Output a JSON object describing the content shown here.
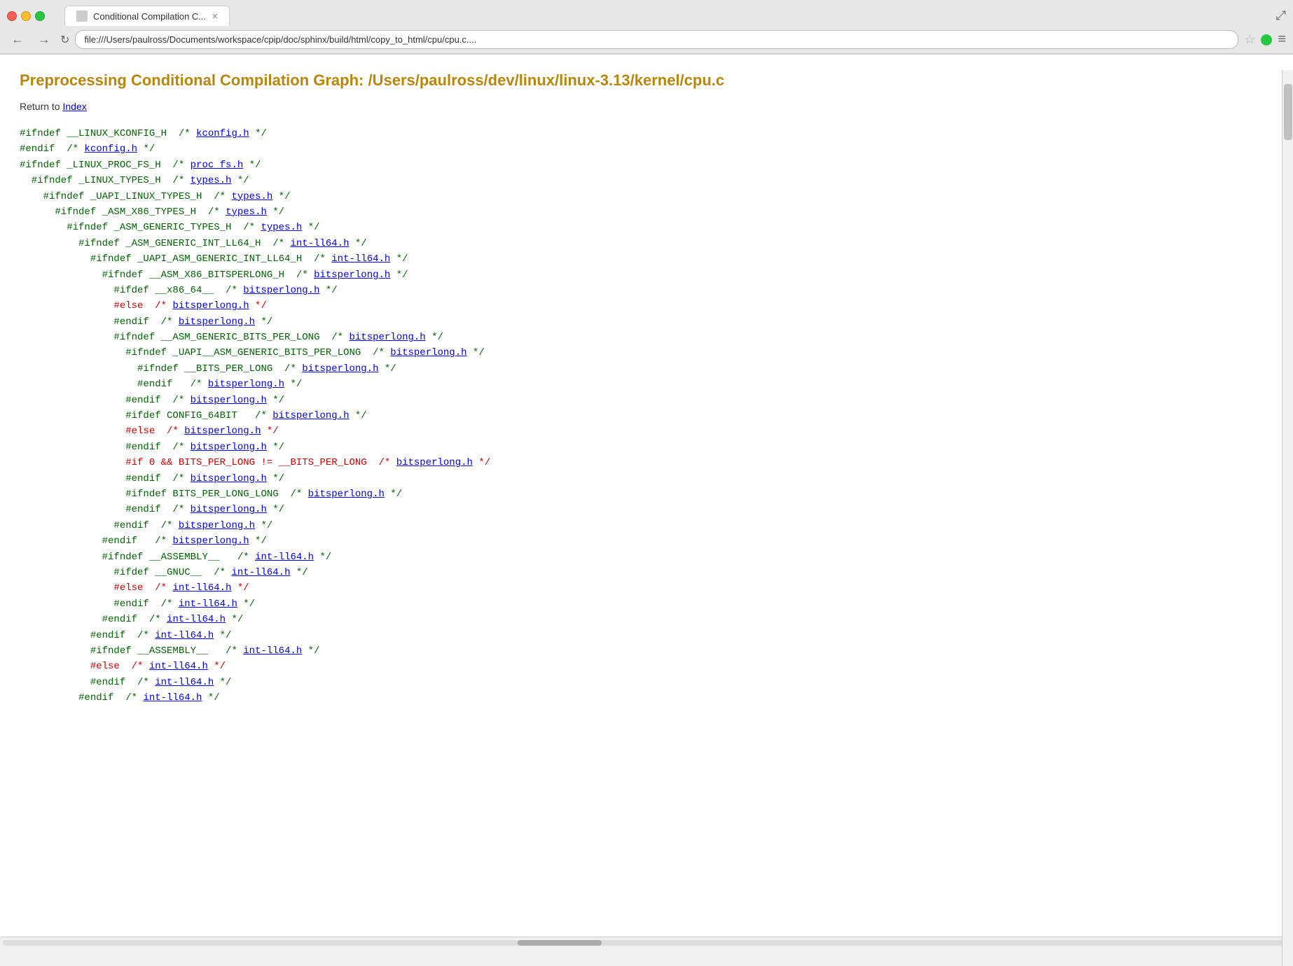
{
  "browser": {
    "tab_title": "Conditional Compilation C...",
    "address": "file:///Users/paulross/Documents/workspace/cpip/doc/sphinx/build/html/copy_to_html/cpu/cpu.c....",
    "nav_back": "←",
    "nav_forward": "→",
    "nav_refresh": "↻"
  },
  "page": {
    "title": "Preprocessing Conditional Compilation Graph: /Users/paulross/dev/linux/linux-3.13/kernel/cpu.c",
    "return_text": "Return to ",
    "return_link_label": "Index",
    "return_link_href": "#"
  },
  "code": {
    "lines": [
      {
        "indent": 0,
        "color": "green",
        "text": "#ifndef __LINUX_KCONFIG_H",
        "comment": "/* ",
        "link": "kconfig.h",
        "comment_end": " */"
      },
      {
        "indent": 0,
        "color": "green",
        "text": "#endif",
        "comment": "  /* ",
        "link": "kconfig.h",
        "comment_end": " */"
      },
      {
        "indent": 0,
        "color": "green",
        "text": "#ifndef _LINUX_PROC_FS_H",
        "comment": "  /* ",
        "link": "proc_fs.h",
        "comment_end": " */"
      },
      {
        "indent": 2,
        "color": "green",
        "text": "#ifndef _LINUX_TYPES_H",
        "comment": "  /* ",
        "link": "types.h",
        "comment_end": " */"
      },
      {
        "indent": 4,
        "color": "green",
        "text": "#ifndef _UAPI_LINUX_TYPES_H",
        "comment": "  /* ",
        "link": "types.h",
        "comment_end": " */"
      },
      {
        "indent": 6,
        "color": "green",
        "text": "#ifndef _ASM_X86_TYPES_H",
        "comment": "  /* ",
        "link": "types.h",
        "comment_end": " */"
      },
      {
        "indent": 8,
        "color": "green",
        "text": "#ifndef _ASM_GENERIC_TYPES_H",
        "comment": "  /* ",
        "link": "types.h",
        "comment_end": " */"
      },
      {
        "indent": 10,
        "color": "green",
        "text": "#ifndef _ASM_GENERIC_INT_LL64_H",
        "comment": "  /* ",
        "link": "int-ll64.h",
        "comment_end": " */"
      },
      {
        "indent": 12,
        "color": "green",
        "text": "#ifndef _UAPI_ASM_GENERIC_INT_LL64_H",
        "comment": "  /* ",
        "link": "int-ll64.h",
        "comment_end": " */"
      },
      {
        "indent": 14,
        "color": "green",
        "text": "#ifndef __ASM_X86_BITSPERLONG_H",
        "comment": "  /* ",
        "link": "bitsperlong.h",
        "comment_end": " */"
      },
      {
        "indent": 16,
        "color": "green",
        "text": "#ifdef __x86_64__",
        "comment": "  /* ",
        "link": "bitsperlong.h",
        "comment_end": " */"
      },
      {
        "indent": 16,
        "color": "red",
        "text": "#else",
        "comment": "  /* ",
        "link": "bitsperlong.h",
        "comment_end": " */"
      },
      {
        "indent": 16,
        "color": "green",
        "text": "#endif",
        "comment": "  /* ",
        "link": "bitsperlong.h",
        "comment_end": " */"
      },
      {
        "indent": 16,
        "color": "green",
        "text": "#ifndef __ASM_GENERIC_BITS_PER_LONG",
        "comment": "  /* ",
        "link": "bitsperlong.h",
        "comment_end": " */"
      },
      {
        "indent": 18,
        "color": "green",
        "text": "#ifndef _UAPI__ASM_GENERIC_BITS_PER_LONG",
        "comment": "  /* ",
        "link": "bitsperlong.h",
        "comment_end": " */"
      },
      {
        "indent": 20,
        "color": "green",
        "text": "#ifndef __BITS_PER_LONG",
        "comment": "  /* ",
        "link": "bitsperlong.h",
        "comment_end": " */"
      },
      {
        "indent": 20,
        "color": "green",
        "text": "#endif",
        "comment": "   /* ",
        "link": "bitsperlong.h",
        "comment_end": " */"
      },
      {
        "indent": 18,
        "color": "green",
        "text": "#endif",
        "comment": "  /* ",
        "link": "bitsperlong.h",
        "comment_end": " */"
      },
      {
        "indent": 18,
        "color": "green",
        "text": "#ifdef CONFIG_64BIT",
        "comment": "   /* ",
        "link": "bitsperlong.h",
        "comment_end": " */"
      },
      {
        "indent": 18,
        "color": "red",
        "text": "#else",
        "comment": "  /* ",
        "link": "bitsperlong.h",
        "comment_end": " */"
      },
      {
        "indent": 18,
        "color": "green",
        "text": "#endif",
        "comment": "  /* ",
        "link": "bitsperlong.h",
        "comment_end": " */"
      },
      {
        "indent": 18,
        "color": "red",
        "text": "#if 0 && BITS_PER_LONG != __BITS_PER_LONG",
        "comment": "  /* ",
        "link": "bitsperlong.h",
        "comment_end": " */"
      },
      {
        "indent": 18,
        "color": "green",
        "text": "#endif",
        "comment": "  /* ",
        "link": "bitsperlong.h",
        "comment_end": " */"
      },
      {
        "indent": 18,
        "color": "green",
        "text": "#ifndef BITS_PER_LONG_LONG",
        "comment": "  /* ",
        "link": "bitsperlong.h",
        "comment_end": " */"
      },
      {
        "indent": 18,
        "color": "green",
        "text": "#endif",
        "comment": "  /* ",
        "link": "bitsperlong.h",
        "comment_end": " */"
      },
      {
        "indent": 16,
        "color": "green",
        "text": "#endif",
        "comment": "  /* ",
        "link": "bitsperlong.h",
        "comment_end": " */"
      },
      {
        "indent": 14,
        "color": "green",
        "text": "#endif",
        "comment": "   /* ",
        "link": "bitsperlong.h",
        "comment_end": " */"
      },
      {
        "indent": 14,
        "color": "green",
        "text": "#ifndef __ASSEMBLY__",
        "comment": "   /* ",
        "link": "int-ll64.h",
        "comment_end": " */"
      },
      {
        "indent": 16,
        "color": "green",
        "text": "#ifdef __GNUC__",
        "comment": "  /* ",
        "link": "int-ll64.h",
        "comment_end": " */"
      },
      {
        "indent": 16,
        "color": "red",
        "text": "#else",
        "comment": "  /* ",
        "link": "int-ll64.h",
        "comment_end": " */"
      },
      {
        "indent": 16,
        "color": "green",
        "text": "#endif",
        "comment": "  /* ",
        "link": "int-ll64.h",
        "comment_end": " */"
      },
      {
        "indent": 14,
        "color": "green",
        "text": "#endif",
        "comment": "  /* ",
        "link": "int-ll64.h",
        "comment_end": " */"
      },
      {
        "indent": 12,
        "color": "green",
        "text": "#endif",
        "comment": "  /* ",
        "link": "int-ll64.h",
        "comment_end": " */"
      },
      {
        "indent": 12,
        "color": "green",
        "text": "#ifndef __ASSEMBLY__",
        "comment": "   /* ",
        "link": "int-ll64.h",
        "comment_end": " */"
      },
      {
        "indent": 14,
        "color": "red",
        "text": "#else",
        "comment": "  /* ",
        "link": "int-ll64.h",
        "comment_end": " */"
      },
      {
        "indent": 14,
        "color": "green",
        "text": "#endif",
        "comment": "  /* ",
        "link": "int-ll64.h",
        "comment_end": " */"
      },
      {
        "indent": 12,
        "color": "green",
        "text": "#endif",
        "comment": "  /* ",
        "link": "int-ll64.h",
        "comment_end": " */"
      }
    ]
  }
}
